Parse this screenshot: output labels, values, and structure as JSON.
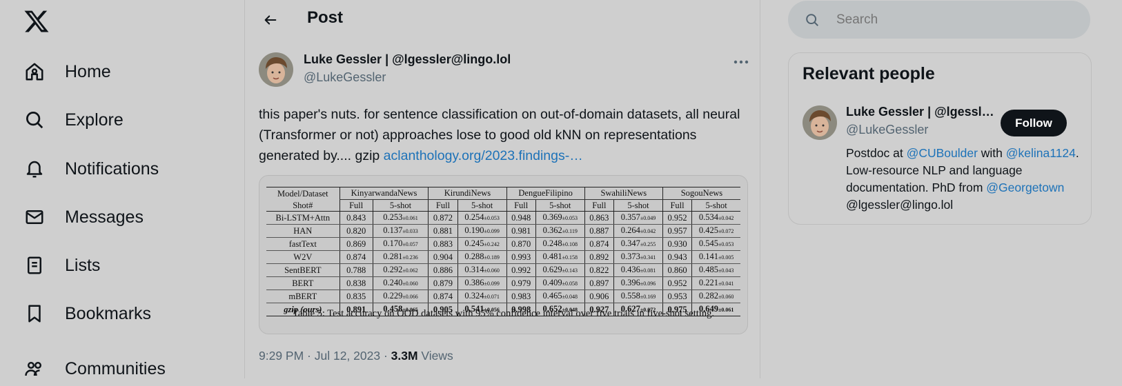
{
  "nav": {
    "items": [
      {
        "label": "Home",
        "icon": "home-icon"
      },
      {
        "label": "Explore",
        "icon": "search-icon"
      },
      {
        "label": "Notifications",
        "icon": "bell-icon"
      },
      {
        "label": "Messages",
        "icon": "envelope-icon"
      },
      {
        "label": "Lists",
        "icon": "list-icon"
      },
      {
        "label": "Bookmarks",
        "icon": "bookmark-icon"
      },
      {
        "label": "Communities",
        "icon": "people-icon"
      }
    ]
  },
  "header": {
    "title": "Post"
  },
  "tweet": {
    "author_name": "Luke Gessler | @lgessler@lingo.lol",
    "author_handle": "@LukeGessler",
    "text_before_link": "this paper's nuts. for sentence classification on out-of-domain datasets, all neural (Transformer or not) approaches lose to good old kNN on representations generated by.... gzip ",
    "link_text": "aclanthology.org/2023.findings-…",
    "time": "9:29 PM · Jul 12, 2023 · ",
    "views_count": "3.3M",
    "views_label": " Views"
  },
  "table": {
    "corner": "Model/Dataset",
    "shot_label": "Shot#",
    "datasets": [
      "KinyarwandaNews",
      "KirundiNews",
      "DengueFilipino",
      "SwahiliNews",
      "SogouNews"
    ],
    "shots": [
      "Full",
      "5-shot"
    ],
    "rows": [
      {
        "model": "Bi-LSTM+Attn",
        "cells": [
          [
            "0.843",
            "0.253",
            "±0.061"
          ],
          [
            "0.872",
            "0.254",
            "±0.053"
          ],
          [
            "0.948",
            "0.369",
            "±0.053"
          ],
          [
            "0.863",
            "0.357",
            "±0.049"
          ],
          [
            "0.952",
            "0.534",
            "±0.042"
          ]
        ]
      },
      {
        "model": "HAN",
        "cells": [
          [
            "0.820",
            "0.137",
            "±0.033"
          ],
          [
            "0.881",
            "0.190",
            "±0.099"
          ],
          [
            "0.981",
            "0.362",
            "±0.119"
          ],
          [
            "0.887",
            "0.264",
            "±0.042"
          ],
          [
            "0.957",
            "0.425",
            "±0.072"
          ]
        ]
      },
      {
        "model": "fastText",
        "cells": [
          [
            "0.869",
            "0.170",
            "±0.057"
          ],
          [
            "0.883",
            "0.245",
            "±0.242"
          ],
          [
            "0.870",
            "0.248",
            "±0.108"
          ],
          [
            "0.874",
            "0.347",
            "±0.255"
          ],
          [
            "0.930",
            "0.545",
            "±0.053"
          ]
        ]
      },
      {
        "model": "W2V",
        "cells": [
          [
            "0.874",
            "0.281",
            "±0.236"
          ],
          [
            "0.904",
            "0.288",
            "±0.189"
          ],
          [
            "0.993",
            "0.481",
            "±0.158"
          ],
          [
            "0.892",
            "0.373",
            "±0.341"
          ],
          [
            "0.943",
            "0.141",
            "±0.005"
          ]
        ]
      },
      {
        "model": "SentBERT",
        "cells": [
          [
            "0.788",
            "0.292",
            "±0.062"
          ],
          [
            "0.886",
            "0.314",
            "±0.060"
          ],
          [
            "0.992",
            "0.629",
            "±0.143"
          ],
          [
            "0.822",
            "0.436",
            "±0.081"
          ],
          [
            "0.860",
            "0.485",
            "±0.043"
          ]
        ]
      },
      {
        "model": "BERT",
        "cells": [
          [
            "0.838",
            "0.240",
            "±0.060"
          ],
          [
            "0.879",
            "0.386",
            "±0.099"
          ],
          [
            "0.979",
            "0.409",
            "±0.058"
          ],
          [
            "0.897",
            "0.396",
            "±0.096"
          ],
          [
            "0.952",
            "0.221",
            "±0.041"
          ]
        ]
      },
      {
        "model": "mBERT",
        "cells": [
          [
            "0.835",
            "0.229",
            "±0.066"
          ],
          [
            "0.874",
            "0.324",
            "±0.071"
          ],
          [
            "0.983",
            "0.465",
            "±0.048"
          ],
          [
            "0.906",
            "0.558",
            "±0.169"
          ],
          [
            "0.953",
            "0.282",
            "±0.060"
          ]
        ]
      },
      {
        "model": "gzip (ours)",
        "cells": [
          [
            "0.891",
            "0.458",
            "±0.065"
          ],
          [
            "0.905",
            "0.541",
            "±0.056"
          ],
          [
            "0.998",
            "0.652",
            "±0.048"
          ],
          [
            "0.927",
            "0.627",
            "±0.072"
          ],
          [
            "0.975",
            "0.649",
            "±0.061"
          ]
        ]
      }
    ],
    "caption": "Table 5: Test accuracy on OOD datasets with 95% confidence interval over five trials in five-shot setting."
  },
  "sidebar": {
    "search_placeholder": "Search",
    "relevant_title": "Relevant people",
    "person": {
      "name": "Luke Gessler | @lgessl…",
      "handle": "@LukeGessler",
      "follow_label": "Follow",
      "bio_1": "Postdoc at ",
      "bio_link_1": "@CUBoulder",
      "bio_2": " with ",
      "bio_link_2": "@kelina1124",
      "bio_3": ". Low-resource NLP and language documentation. PhD from ",
      "bio_link_3": "@Georgetown",
      "bio_4": " @lgessler@lingo.lol"
    }
  },
  "colors": {
    "link": "#1d72b8",
    "text": "#0f1419",
    "muted": "#536471",
    "background": "#cfcfcf"
  }
}
